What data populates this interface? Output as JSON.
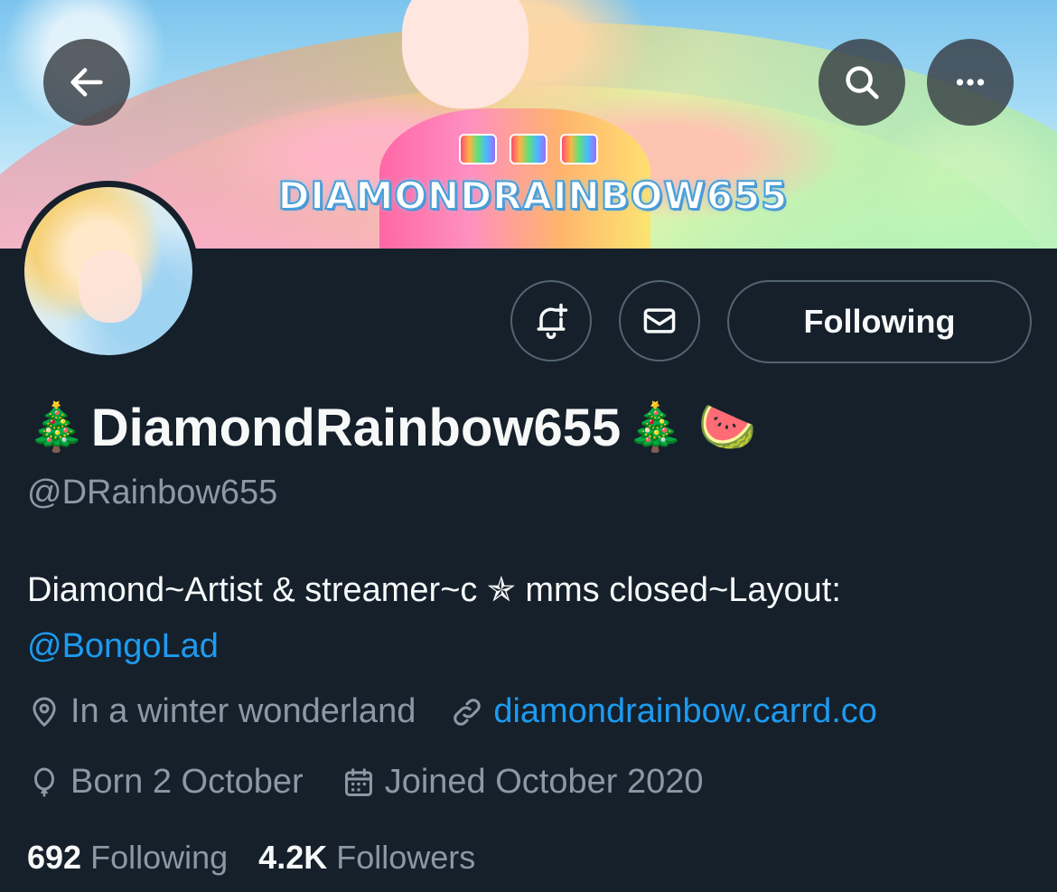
{
  "banner": {
    "logo_text": "DIAMONDRAINBOW655"
  },
  "top_actions": {
    "back_icon": "arrow-left-icon",
    "search_icon": "search-icon",
    "more_icon": "more-horizontal-icon"
  },
  "profile_actions": {
    "notify_icon": "bell-plus-icon",
    "message_icon": "envelope-icon",
    "follow_label": "Following"
  },
  "profile": {
    "name_prefix_emoji": "🎄",
    "display_name": "DiamondRainbow655",
    "name_suffix_emoji": "🎄 🍉",
    "handle": "@DRainbow655",
    "bio_text": "Diamond~Artist & streamer~c ✯ mms closed~Layout:",
    "bio_mention": "@BongoLad",
    "location": "In a winter wonderland",
    "website": "diamondrainbow.carrd.co",
    "birthday": "Born 2 October",
    "joined": "Joined October 2020"
  },
  "stats": {
    "following_count": "692",
    "following_label": "Following",
    "followers_count": "4.2K",
    "followers_label": "Followers"
  },
  "colors": {
    "background": "#15202b",
    "text_primary": "#f7f9f9",
    "text_secondary": "#8b98a5",
    "link": "#1d9bf0",
    "border": "#536471"
  }
}
